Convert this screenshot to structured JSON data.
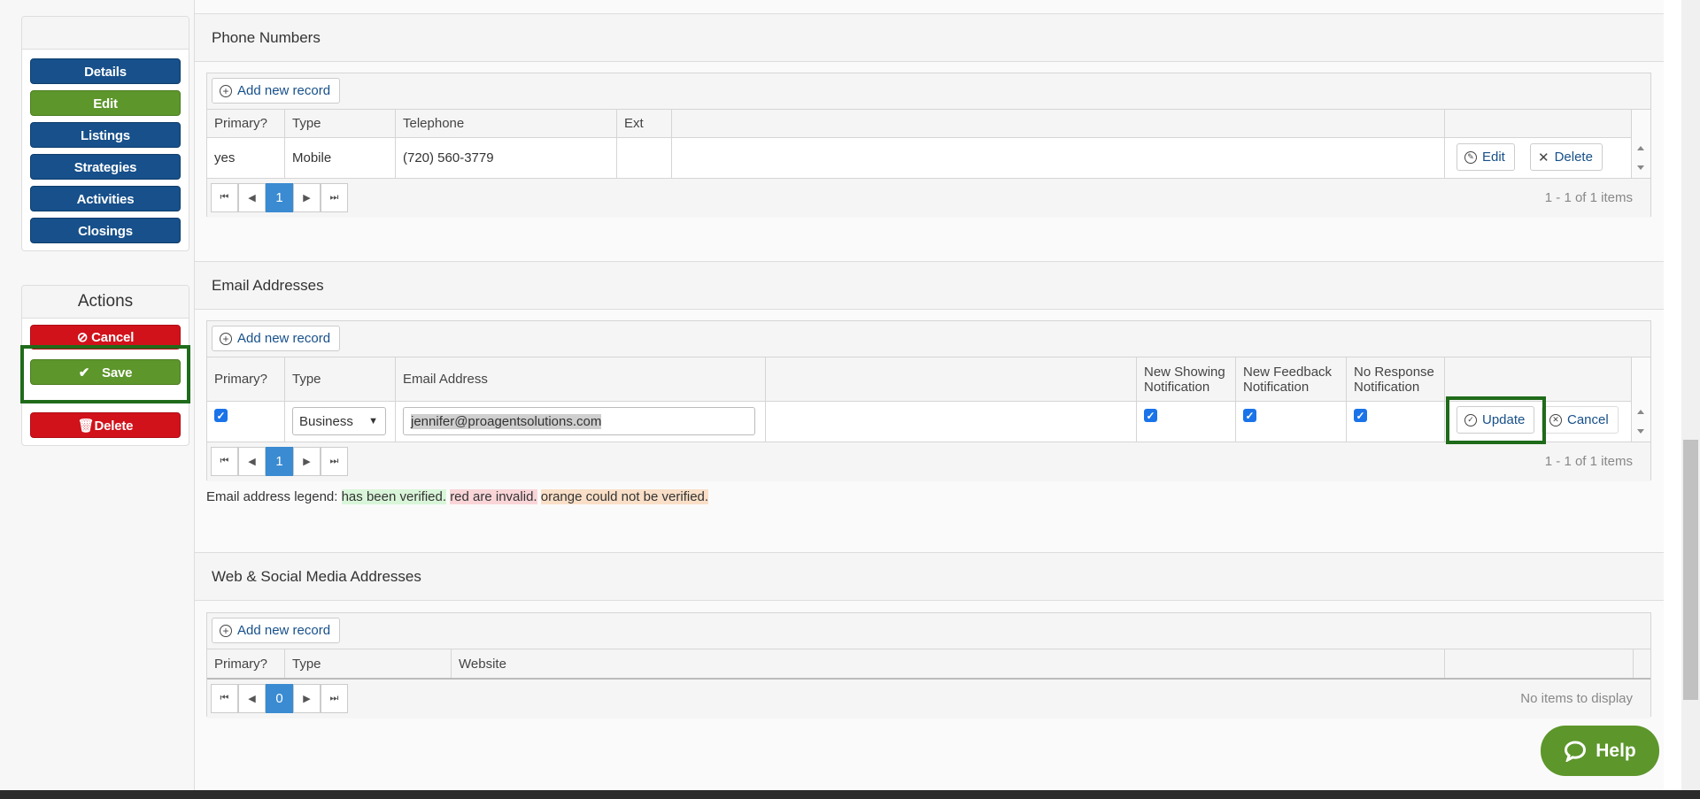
{
  "sidebar": {
    "nav": [
      {
        "label": "Details",
        "color": "#17508a"
      },
      {
        "label": "Edit",
        "color": "#5d962b"
      },
      {
        "label": "Listings",
        "color": "#17508a"
      },
      {
        "label": "Strategies",
        "color": "#17508a"
      },
      {
        "label": "Activities",
        "color": "#17508a"
      },
      {
        "label": "Closings",
        "color": "#17508a"
      }
    ],
    "actions_title": "Actions",
    "cancel_label": "Cancel",
    "save_label": "Save",
    "delete_label": "Delete"
  },
  "phones": {
    "title": "Phone Numbers",
    "add_label": "Add new record",
    "columns": [
      "Primary?",
      "Type",
      "Telephone",
      "Ext"
    ],
    "rows": [
      {
        "primary": "yes",
        "type": "Mobile",
        "telephone": "(720) 560-3779",
        "ext": ""
      }
    ],
    "edit_label": "Edit",
    "delete_label": "Delete",
    "page": "1",
    "pager_info": "1 - 1 of 1 items"
  },
  "emails": {
    "title": "Email Addresses",
    "add_label": "Add new record",
    "columns": [
      "Primary?",
      "Type",
      "Email Address",
      "New Showing Notification",
      "New Feedback Notification",
      "No Response Notification"
    ],
    "row": {
      "primary_checked": true,
      "type": "Business",
      "email": "jennifer@proagentsolutions.com",
      "new_showing": true,
      "new_feedback": true,
      "no_response": true
    },
    "update_label": "Update",
    "cancel_label": "Cancel",
    "page": "1",
    "pager_info": "1 - 1 of 1 items",
    "legend_prefix": "Email address legend:",
    "legend_verified": "has been verified.",
    "legend_invalid": "red are invalid.",
    "legend_unverified": "orange could not be verified."
  },
  "web": {
    "title": "Web & Social Media Addresses",
    "add_label": "Add new record",
    "columns": [
      "Primary?",
      "Type",
      "Website"
    ],
    "page": "0",
    "pager_info": "No items to display"
  },
  "help_label": "Help",
  "colors": {
    "brand_blue": "#17508a",
    "brand_green": "#5d962b",
    "danger_red": "#d1121b",
    "highlight": "#1f6b1a",
    "pager_active": "#3a8bd1"
  }
}
